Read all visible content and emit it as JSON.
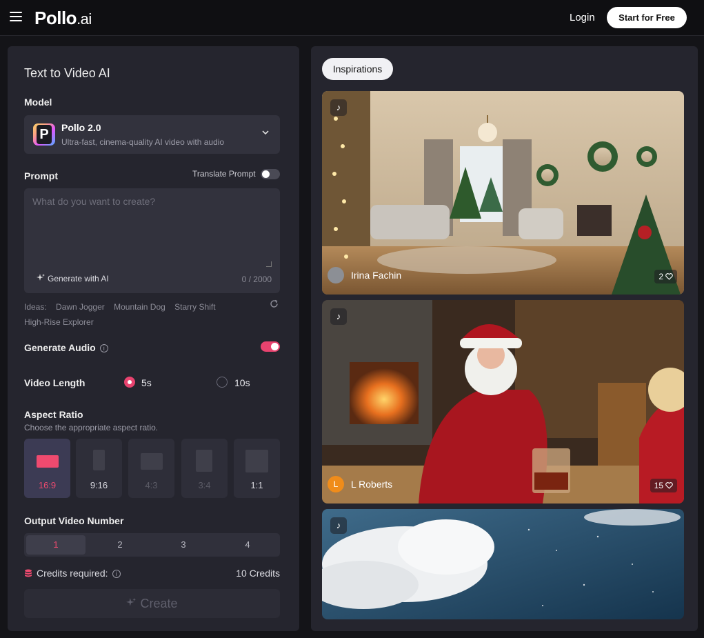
{
  "header": {
    "logo_main": "Pollo",
    "logo_suffix": ".ai",
    "login_label": "Login",
    "start_label": "Start for Free"
  },
  "panel": {
    "title": "Text to Video AI",
    "model_label": "Model",
    "model": {
      "name": "Pollo 2.0",
      "description": "Ultra-fast, cinema-quality AI video with audio"
    },
    "prompt_label": "Prompt",
    "translate_label": "Translate Prompt",
    "translate_enabled": false,
    "prompt_placeholder": "What do you want to create?",
    "generate_ai_label": "Generate with AI",
    "counter": "0 / 2000",
    "ideas_label": "Ideas:",
    "ideas": [
      "Dawn Jogger",
      "Mountain Dog",
      "Starry Shift",
      "High-Rise Explorer"
    ],
    "audio_label": "Generate Audio",
    "audio_enabled": true,
    "length_label": "Video Length",
    "length_options": [
      "5s",
      "10s"
    ],
    "length_selected": "5s",
    "aspect_label": "Aspect Ratio",
    "aspect_sub": "Choose the appropriate aspect ratio.",
    "aspect_options": [
      "16:9",
      "9:16",
      "4:3",
      "3:4",
      "1:1"
    ],
    "aspect_selected": "16:9",
    "output_label": "Output Video Number",
    "output_options": [
      "1",
      "2",
      "3",
      "4"
    ],
    "output_selected": "1",
    "credits_label": "Credits required:",
    "credits_value": "10 Credits",
    "create_label": "Create"
  },
  "inspirations": {
    "tab_label": "Inspirations",
    "cards": [
      {
        "author": "Irina Fachin",
        "likes": "2"
      },
      {
        "author": "L Roberts",
        "avatar_letter": "L",
        "likes": "15"
      },
      {}
    ]
  },
  "colors": {
    "accent": "#e8436f",
    "panel": "#25252e",
    "background": "#141418"
  }
}
